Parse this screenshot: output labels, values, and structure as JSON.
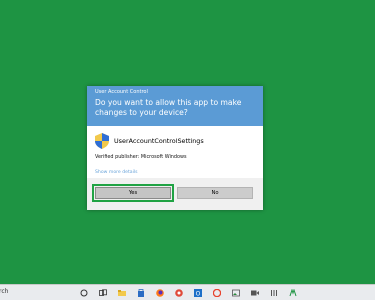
{
  "taskbar": {
    "search_text": "rch"
  },
  "dialog": {
    "title": "User Account Control",
    "question": "Do you want to allow this app to make changes to your device?",
    "app_name": "UserAccountControlSettings",
    "publisher": "Verified publisher: Microsoft Windows",
    "more_details": "Show more details",
    "yes_label": "Yes",
    "no_label": "No"
  },
  "colors": {
    "desktop": "#1e9443",
    "dialog_header": "#5b9bd5",
    "focus_outline": "#20a344"
  },
  "taskbar_icons": [
    "cortana-icon",
    "task-view-icon",
    "file-explorer-icon",
    "store-icon",
    "firefox-icon",
    "chrome-icon",
    "opera-icon",
    "outlook-icon",
    "gallery-icon",
    "video-icon",
    "mixer-icon",
    "network-icon"
  ]
}
